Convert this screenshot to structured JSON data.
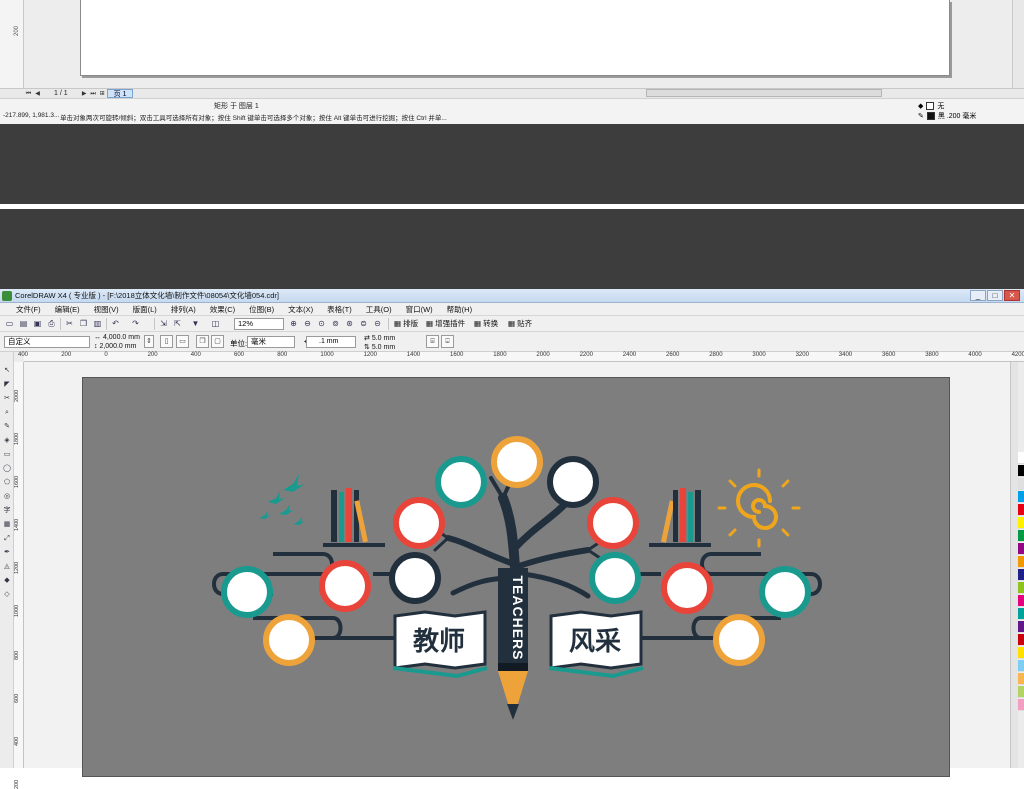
{
  "top_window": {
    "ruler_tick": "200",
    "page_nav": {
      "first": "⏮",
      "prev": "◀",
      "page_count": "1 / 1",
      "next": "▶",
      "last": "⏭",
      "add": "⊞"
    },
    "page_tab": "页 1",
    "object_info": "矩形 于 图层 1",
    "coords": "-217.899, 1,981.3...",
    "hint": "单击对象两次可旋转/倾斜；双击工具可选择所有对象；按住 Shift 键单击可选择多个对象；按住 Alt 键单击可进行挖掘；按住 Ctrl 并单...",
    "fill_label": "无",
    "outline_label": "黑 .200 毫米"
  },
  "window": {
    "title": "CorelDRAW X4 ( 专业版 ) - [F:\\2018立体文化墙\\制作文件\\08054\\文化墙054.cdr]",
    "controls": {
      "minimize": "_",
      "maximize": "□",
      "close": "✕"
    },
    "menu": [
      "文件(F)",
      "编辑(E)",
      "视图(V)",
      "版面(L)",
      "排列(A)",
      "效果(C)",
      "位图(B)",
      "文本(X)",
      "表格(T)",
      "工具(O)",
      "窗口(W)",
      "帮助(H)"
    ],
    "toolbar": {
      "zoom": "12%",
      "plugins": [
        "排版",
        "增强插件",
        "转换",
        "贴齐"
      ]
    },
    "propbar": {
      "preset": "自定义",
      "width": "4,000.0 mm",
      "height": "2,000.0 mm",
      "unit_label": "单位:",
      "unit": "毫米",
      "nudge": ".1 mm",
      "dup_x": "5.0 mm",
      "dup_y": "5.0 mm"
    },
    "hruler_ticks": [
      "400",
      "200",
      "0",
      "200",
      "400",
      "600",
      "800",
      "1000",
      "1200",
      "1400",
      "1600",
      "1800",
      "2000",
      "2200",
      "2400",
      "2600",
      "2800",
      "3000",
      "3200",
      "3400",
      "3600",
      "3800",
      "4000",
      "4200"
    ],
    "vruler_ticks": [
      "2000",
      "1800",
      "1600",
      "1400",
      "1200",
      "1000",
      "800",
      "600",
      "400",
      "200"
    ]
  },
  "artwork": {
    "left_title": "教师",
    "right_title": "风采",
    "trunk_text": "TEACHERS",
    "colors": {
      "teal": "#1a9a8f",
      "red": "#e8443a",
      "orange": "#eda33a",
      "navy": "#22303e",
      "page_bg": "#7e7e7e",
      "sun": "#efa61d"
    }
  }
}
